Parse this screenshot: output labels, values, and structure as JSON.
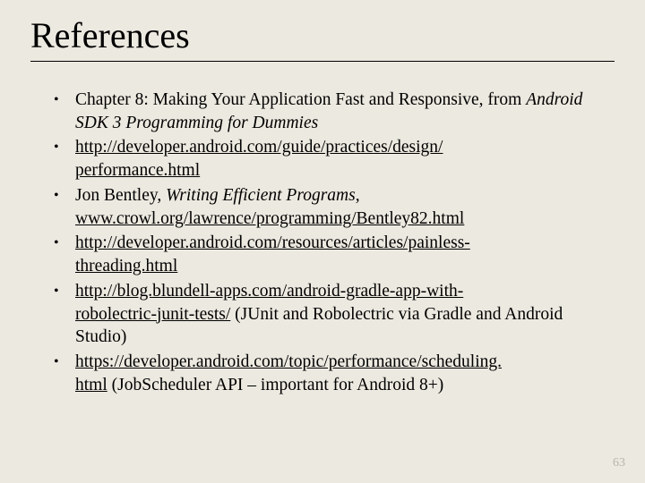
{
  "title": "References",
  "items": [
    {
      "pre": "Chapter 8: Making Your Application Fast and Responsive, from ",
      "italic": "Android SDK 3 Programming for Dummies"
    },
    {
      "link1": "http://developer.android.com/guide/practices/design/",
      "link2": "performance.html"
    },
    {
      "pre": "Jon Bentley, ",
      "italic": "Writing Efficient Programs",
      "mid": ", ",
      "link1": "www.crowl.org/lawrence/programming/Bentley82.html"
    },
    {
      "link1": "http://developer.android.com/resources/articles/painless-",
      "link2": "threading.html"
    },
    {
      "link1": "http://blog.blundell-apps.com/android-gradle-app-with-",
      "link2": "robolectric-junit-tests/",
      "post": " (JUnit and Robolectric via Gradle and Android Studio)"
    },
    {
      "link1": "https://developer.android.com/topic/performance/scheduling.",
      "link2": "html",
      "post": " (JobScheduler API – important for Android 8+)"
    }
  ],
  "page_number": "63"
}
